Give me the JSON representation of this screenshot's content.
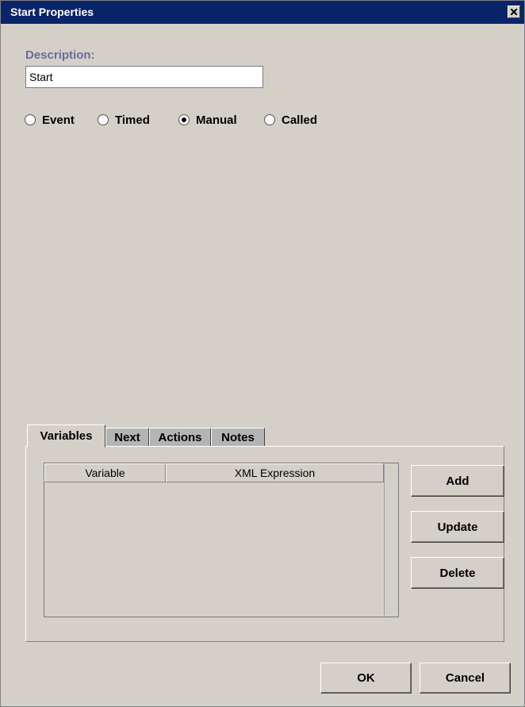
{
  "window": {
    "title": "Start Properties"
  },
  "description": {
    "label": "Description:",
    "value": "Start"
  },
  "start_type": {
    "options": [
      "Event",
      "Timed",
      "Manual",
      "Called"
    ],
    "selected": "Manual"
  },
  "tabs": [
    {
      "label": "Variables",
      "active": true
    },
    {
      "label": "Next",
      "active": false
    },
    {
      "label": "Actions",
      "active": false
    },
    {
      "label": "Notes",
      "active": false
    }
  ],
  "variables_table": {
    "columns": [
      "Variable",
      "XML Expression"
    ],
    "rows": []
  },
  "side_buttons": {
    "add": "Add",
    "update": "Update",
    "delete": "Delete"
  },
  "footer": {
    "ok": "OK",
    "cancel": "Cancel"
  },
  "colors": {
    "titlebar": "#0a246a",
    "label": "#6b6b9e",
    "face": "#d4d0c8"
  }
}
